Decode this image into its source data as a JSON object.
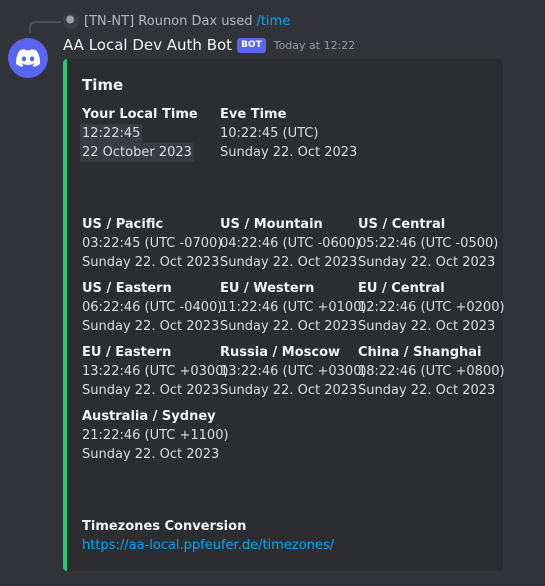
{
  "reply": {
    "user": "[TN-NT] Rounon Dax",
    "used": "used",
    "command": "/time"
  },
  "message": {
    "bot_name": "AA Local Dev Auth Bot",
    "badge": "BOT",
    "timestamp": "Today at 12:22"
  },
  "embed": {
    "accent_color": "#2dc770",
    "title": "Time",
    "local": {
      "name": "Your Local Time",
      "time": "12:22:45",
      "date": "22 October 2023"
    },
    "eve": {
      "name": "Eve Time",
      "time": "10:22:45 (UTC)",
      "date": "Sunday 22. Oct 2023"
    },
    "zones": [
      {
        "name": "US / Pacific",
        "time": "03:22:45 (UTC -0700)",
        "date": "Sunday 22. Oct 2023"
      },
      {
        "name": "US / Mountain",
        "time": "04:22:46 (UTC -0600)",
        "date": "Sunday 22. Oct 2023"
      },
      {
        "name": "US / Central",
        "time": "05:22:46 (UTC -0500)",
        "date": "Sunday 22. Oct 2023"
      },
      {
        "name": "US / Eastern",
        "time": "06:22:46 (UTC -0400)",
        "date": "Sunday 22. Oct 2023"
      },
      {
        "name": "EU / Western",
        "time": "11:22:46 (UTC +0100)",
        "date": "Sunday 22. Oct 2023"
      },
      {
        "name": "EU / Central",
        "time": "12:22:46 (UTC +0200)",
        "date": "Sunday 22. Oct 2023"
      },
      {
        "name": "EU / Eastern",
        "time": "13:22:46 (UTC +0300)",
        "date": "Sunday 22. Oct 2023"
      },
      {
        "name": "Russia / Moscow",
        "time": "13:22:46 (UTC +0300)",
        "date": "Sunday 22. Oct 2023"
      },
      {
        "name": "China / Shanghai",
        "time": "18:22:46 (UTC +0800)",
        "date": "Sunday 22. Oct 2023"
      },
      {
        "name": "Australia / Sydney",
        "time": "21:22:46 (UTC +1100)",
        "date": "Sunday 22. Oct 2023"
      }
    ],
    "conversion": {
      "name": "Timezones Conversion",
      "url": "https://aa-local.ppfeufer.de/timezones/"
    }
  }
}
